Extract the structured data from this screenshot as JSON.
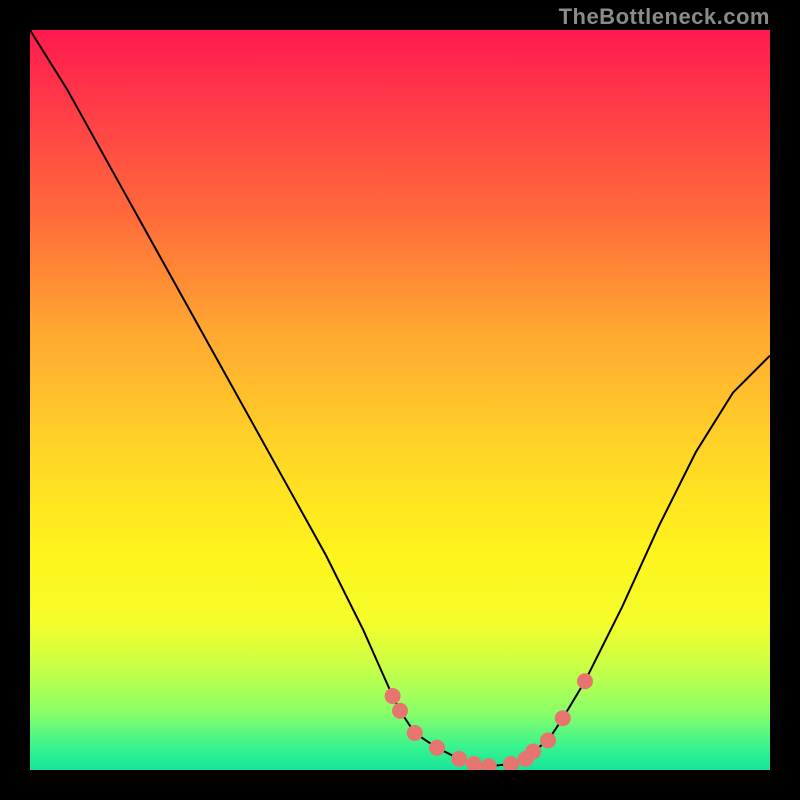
{
  "watermark": "TheBottleneck.com",
  "chart_data": {
    "type": "line",
    "title": "",
    "xlabel": "",
    "ylabel": "",
    "xlim": [
      0,
      100
    ],
    "ylim": [
      0,
      100
    ],
    "categories": [
      0,
      5,
      10,
      15,
      20,
      25,
      30,
      35,
      40,
      45,
      49,
      50,
      52,
      55,
      58,
      60,
      62,
      65,
      67,
      68,
      70,
      72,
      75,
      80,
      85,
      90,
      95,
      100
    ],
    "series": [
      {
        "name": "bottleneck-curve",
        "values": [
          100,
          92,
          83,
          74,
          65,
          56,
          47,
          38,
          29,
          19,
          10,
          8,
          5,
          3,
          1.5,
          0.8,
          0.5,
          0.8,
          1.5,
          2.5,
          4,
          7,
          12,
          22,
          33,
          43,
          51,
          56
        ]
      }
    ],
    "markers": {
      "name": "highlight-points",
      "points": [
        {
          "x": 49,
          "y": 10
        },
        {
          "x": 50,
          "y": 8
        },
        {
          "x": 52,
          "y": 5
        },
        {
          "x": 55,
          "y": 3
        },
        {
          "x": 58,
          "y": 1.5
        },
        {
          "x": 60,
          "y": 0.8
        },
        {
          "x": 62,
          "y": 0.5
        },
        {
          "x": 65,
          "y": 0.8
        },
        {
          "x": 67,
          "y": 1.5
        },
        {
          "x": 68,
          "y": 2.5
        },
        {
          "x": 70,
          "y": 4
        },
        {
          "x": 72,
          "y": 7
        },
        {
          "x": 75,
          "y": 12
        }
      ]
    },
    "background_gradient": {
      "top": "#ff1a4f",
      "middle": "#fff31c",
      "bottom": "#18e49a"
    }
  }
}
